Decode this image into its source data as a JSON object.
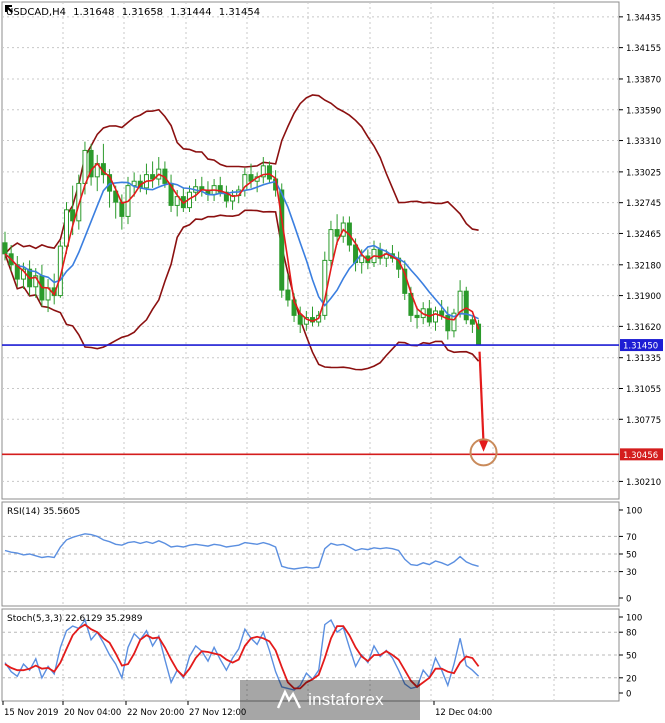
{
  "header": {
    "symbol": "USDCAD,H4",
    "open": "1.31648",
    "high": "1.31658",
    "low": "1.31444",
    "close": "1.31454"
  },
  "watermark": {
    "text": "instaforex"
  },
  "colors": {
    "candle": "#2b9a2b",
    "ma_fast": "#e31b1b",
    "ma_mid": "#3b7fe0",
    "bands": "#8b1010",
    "level_support": "#1d1dd4",
    "level_target": "#d41d1d",
    "osc_rsi": "#5b8fe0",
    "osc_stoch_signal": "#e31b1b"
  },
  "chart_data": [
    {
      "type": "candlestick",
      "title": "USDCAD,H4 1.31648 1.31658 1.31444 1.31454",
      "x_tick_labels": [
        "15 Nov 2019",
        "20 Nov 04:00",
        "22 Nov 20:00",
        "27 Nov 12:00",
        "12 Dec 04:00"
      ],
      "y_tick_labels": [
        "1.34435",
        "1.34155",
        "1.33870",
        "1.33590",
        "1.33310",
        "1.33025",
        "1.32745",
        "1.32465",
        "1.32180",
        "1.31900",
        "1.31620",
        "1.31335",
        "1.31055",
        "1.30775",
        "1.30210"
      ],
      "ylim": [
        1.3005,
        1.3457
      ],
      "horizontal_levels": [
        {
          "value": 1.3145,
          "label": "1.31450"
        },
        {
          "value": 1.30456,
          "label": "1.30456"
        }
      ],
      "projection_arrow": {
        "from": 1.3139,
        "to": 1.3048
      },
      "candles_ohlc": [
        [
          1.3238,
          1.3248,
          1.3222,
          1.3228
        ],
        [
          1.3228,
          1.3236,
          1.3212,
          1.3218
        ],
        [
          1.3218,
          1.3226,
          1.3198,
          1.3205
        ],
        [
          1.3205,
          1.322,
          1.3196,
          1.3214
        ],
        [
          1.3214,
          1.3222,
          1.319,
          1.3198
        ],
        [
          1.3198,
          1.3215,
          1.3188,
          1.3208
        ],
        [
          1.3208,
          1.3218,
          1.318,
          1.3186
        ],
        [
          1.3186,
          1.3205,
          1.3175,
          1.3197
        ],
        [
          1.3197,
          1.321,
          1.3182,
          1.319
        ],
        [
          1.319,
          1.324,
          1.3188,
          1.3235
        ],
        [
          1.3235,
          1.3275,
          1.3228,
          1.3268
        ],
        [
          1.3268,
          1.329,
          1.3245,
          1.3258
        ],
        [
          1.3258,
          1.33,
          1.325,
          1.3292
        ],
        [
          1.3292,
          1.333,
          1.3282,
          1.3322
        ],
        [
          1.3322,
          1.3328,
          1.329,
          1.3298
        ],
        [
          1.3298,
          1.3318,
          1.3285,
          1.331
        ],
        [
          1.331,
          1.3328,
          1.3292,
          1.33
        ],
        [
          1.33,
          1.3305,
          1.327,
          1.3285
        ],
        [
          1.3285,
          1.329,
          1.326,
          1.3275
        ],
        [
          1.3275,
          1.3282,
          1.325,
          1.3262
        ],
        [
          1.3262,
          1.3298,
          1.3255,
          1.329
        ],
        [
          1.329,
          1.3302,
          1.328,
          1.3294
        ],
        [
          1.3294,
          1.33,
          1.3284,
          1.3288
        ],
        [
          1.3288,
          1.331,
          1.3282,
          1.33
        ],
        [
          1.33,
          1.3312,
          1.3288,
          1.3296
        ],
        [
          1.3296,
          1.3316,
          1.329,
          1.3305
        ],
        [
          1.3305,
          1.3312,
          1.3288,
          1.3292
        ],
        [
          1.3292,
          1.33,
          1.3266,
          1.3272
        ],
        [
          1.3272,
          1.3286,
          1.3262,
          1.328
        ],
        [
          1.328,
          1.3288,
          1.3266,
          1.327
        ],
        [
          1.327,
          1.329,
          1.3266,
          1.3284
        ],
        [
          1.3284,
          1.3296,
          1.3276,
          1.3289
        ],
        [
          1.3289,
          1.3298,
          1.328,
          1.3286
        ],
        [
          1.3286,
          1.3294,
          1.3276,
          1.3282
        ],
        [
          1.3282,
          1.3296,
          1.3276,
          1.329
        ],
        [
          1.329,
          1.3298,
          1.328,
          1.3284
        ],
        [
          1.3284,
          1.329,
          1.327,
          1.3276
        ],
        [
          1.3276,
          1.3286,
          1.3268,
          1.3281
        ],
        [
          1.3281,
          1.329,
          1.3274,
          1.3286
        ],
        [
          1.3286,
          1.3306,
          1.328,
          1.33
        ],
        [
          1.33,
          1.331,
          1.3288,
          1.3294
        ],
        [
          1.3294,
          1.3302,
          1.3284,
          1.3298
        ],
        [
          1.3298,
          1.3316,
          1.3292,
          1.3308
        ],
        [
          1.3308,
          1.3312,
          1.3292,
          1.3296
        ],
        [
          1.3296,
          1.3304,
          1.328,
          1.3286
        ],
        [
          1.3286,
          1.3292,
          1.3188,
          1.3195
        ],
        [
          1.3195,
          1.321,
          1.318,
          1.3186
        ],
        [
          1.3186,
          1.3192,
          1.3166,
          1.3172
        ],
        [
          1.3172,
          1.318,
          1.3156,
          1.3164
        ],
        [
          1.3164,
          1.3176,
          1.3158,
          1.317
        ],
        [
          1.317,
          1.318,
          1.3162,
          1.3166
        ],
        [
          1.3166,
          1.3176,
          1.3162,
          1.3172
        ],
        [
          1.3172,
          1.323,
          1.3168,
          1.3222
        ],
        [
          1.3222,
          1.3258,
          1.3215,
          1.325
        ],
        [
          1.325,
          1.3264,
          1.3236,
          1.3244
        ],
        [
          1.3244,
          1.3262,
          1.3238,
          1.3256
        ],
        [
          1.3256,
          1.3262,
          1.323,
          1.3236
        ],
        [
          1.3236,
          1.3242,
          1.3212,
          1.322
        ],
        [
          1.322,
          1.3232,
          1.321,
          1.3226
        ],
        [
          1.3226,
          1.3232,
          1.3214,
          1.322
        ],
        [
          1.322,
          1.324,
          1.3216,
          1.3232
        ],
        [
          1.3232,
          1.3238,
          1.3218,
          1.3224
        ],
        [
          1.3224,
          1.3232,
          1.3216,
          1.3228
        ],
        [
          1.3228,
          1.3236,
          1.322,
          1.3224
        ],
        [
          1.3224,
          1.323,
          1.3206,
          1.3214
        ],
        [
          1.3214,
          1.3222,
          1.3186,
          1.3192
        ],
        [
          1.3192,
          1.3198,
          1.3166,
          1.3172
        ],
        [
          1.3172,
          1.318,
          1.316,
          1.317
        ],
        [
          1.317,
          1.3184,
          1.3164,
          1.3178
        ],
        [
          1.3178,
          1.3186,
          1.3162,
          1.3166
        ],
        [
          1.3166,
          1.318,
          1.3158,
          1.3176
        ],
        [
          1.3176,
          1.3186,
          1.3168,
          1.3172
        ],
        [
          1.3172,
          1.318,
          1.315,
          1.3158
        ],
        [
          1.3158,
          1.3178,
          1.3152,
          1.3174
        ],
        [
          1.3174,
          1.3204,
          1.317,
          1.3194
        ],
        [
          1.3194,
          1.3198,
          1.3164,
          1.3168
        ],
        [
          1.3168,
          1.3172,
          1.3156,
          1.3164
        ],
        [
          1.3164,
          1.3168,
          1.3146,
          1.3146
        ]
      ],
      "overlays": [
        "fast moving average",
        "slow moving average",
        "Bollinger Bands (upper / lower)"
      ]
    },
    {
      "type": "line",
      "title": "RSI(14) 35.5605",
      "ylim": [
        0,
        100
      ],
      "y_tick_labels": [
        "100",
        "70",
        "50",
        "30",
        "0"
      ],
      "levels": [
        70,
        50,
        30
      ],
      "series": [
        {
          "name": "RSI(14)",
          "values": [
            54,
            52,
            51,
            49,
            50,
            48,
            46,
            47,
            46,
            58,
            66,
            69,
            71,
            73,
            72,
            70,
            66,
            64,
            61,
            60,
            63,
            64,
            62,
            64,
            62,
            65,
            62,
            58,
            59,
            58,
            60,
            61,
            60,
            59,
            61,
            60,
            58,
            59,
            60,
            63,
            62,
            61,
            63,
            61,
            58,
            36,
            34,
            33,
            34,
            35,
            34,
            35,
            56,
            62,
            60,
            61,
            58,
            54,
            56,
            55,
            57,
            56,
            57,
            56,
            54,
            44,
            38,
            37,
            40,
            38,
            42,
            40,
            37,
            41,
            47,
            41,
            38,
            36
          ]
        }
      ]
    },
    {
      "type": "line",
      "title": "Stoch(5,3,3) 22.6129 35.2989",
      "ylim": [
        0,
        100
      ],
      "y_tick_labels": [
        "100",
        "80",
        "50",
        "20",
        "0"
      ],
      "levels": [
        80,
        50,
        20
      ],
      "series": [
        {
          "name": "Stoch(5,3,3)",
          "values": [
            40,
            28,
            22,
            38,
            30,
            45,
            20,
            35,
            25,
            60,
            82,
            88,
            85,
            96,
            70,
            80,
            66,
            50,
            38,
            20,
            60,
            78,
            70,
            82,
            62,
            75,
            44,
            14,
            30,
            20,
            48,
            62,
            55,
            42,
            60,
            44,
            30,
            46,
            58,
            84,
            72,
            64,
            80,
            56,
            28,
            8,
            6,
            4,
            10,
            26,
            18,
            30,
            90,
            96,
            80,
            86,
            60,
            35,
            50,
            40,
            62,
            48,
            56,
            46,
            30,
            12,
            6,
            8,
            30,
            20,
            46,
            30,
            10,
            38,
            72,
            36,
            30,
            22
          ]
        },
        {
          "name": "Signal",
          "values": [
            38,
            33,
            30,
            30,
            32,
            36,
            32,
            33,
            28,
            40,
            58,
            76,
            85,
            90,
            84,
            80,
            72,
            66,
            52,
            36,
            38,
            52,
            70,
            76,
            72,
            73,
            60,
            44,
            30,
            22,
            32,
            46,
            55,
            54,
            52,
            50,
            44,
            40,
            44,
            62,
            72,
            74,
            72,
            68,
            56,
            34,
            14,
            6,
            6,
            14,
            18,
            24,
            46,
            72,
            88,
            88,
            76,
            60,
            48,
            42,
            50,
            50,
            55,
            50,
            44,
            30,
            16,
            8,
            14,
            20,
            32,
            32,
            28,
            26,
            40,
            48,
            46,
            35
          ]
        }
      ]
    }
  ]
}
